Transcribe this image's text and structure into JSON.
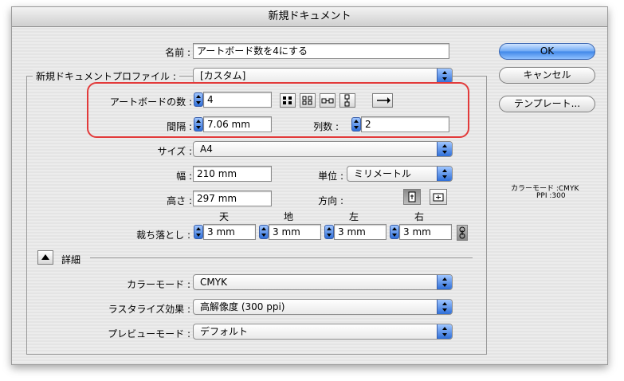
{
  "window": {
    "title": "新規ドキュメント"
  },
  "name": {
    "label": "名前 :",
    "value": "アートボード数を4にする"
  },
  "profile": {
    "label": "新規ドキュメントプロファイル :",
    "value": "[カスタム]"
  },
  "artboards": {
    "count_label": "アートボードの数 :",
    "count_value": "4",
    "spacing_label": "間隔 :",
    "spacing_value": "7.06 mm",
    "columns_label": "列数 :",
    "columns_value": "2"
  },
  "size": {
    "label": "サイズ :",
    "value": "A4"
  },
  "width": {
    "label": "幅 :",
    "value": "210 mm"
  },
  "unit": {
    "label": "単位 :",
    "value": "ミリメートル"
  },
  "height": {
    "label": "高さ :",
    "value": "297 mm"
  },
  "orientation": {
    "label": "方向 :"
  },
  "bleed": {
    "label": "裁ち落とし :",
    "top_label": "天",
    "bottom_label": "地",
    "left_label": "左",
    "right_label": "右",
    "top": "3 mm",
    "bottom": "3 mm",
    "left": "3 mm",
    "right": "3 mm"
  },
  "advanced": {
    "label": "詳細"
  },
  "color_mode": {
    "label": "カラーモード :",
    "value": "CMYK"
  },
  "raster_effects": {
    "label": "ラスタライズ効果 :",
    "value": "高解像度 (300 ppi)"
  },
  "preview_mode": {
    "label": "プレビューモード :",
    "value": "デフォルト"
  },
  "buttons": {
    "ok": "OK",
    "cancel": "キャンセル",
    "templates": "テンプレート..."
  },
  "info": {
    "color_mode": "カラーモード :CMYK",
    "ppi": "PPI :300"
  }
}
